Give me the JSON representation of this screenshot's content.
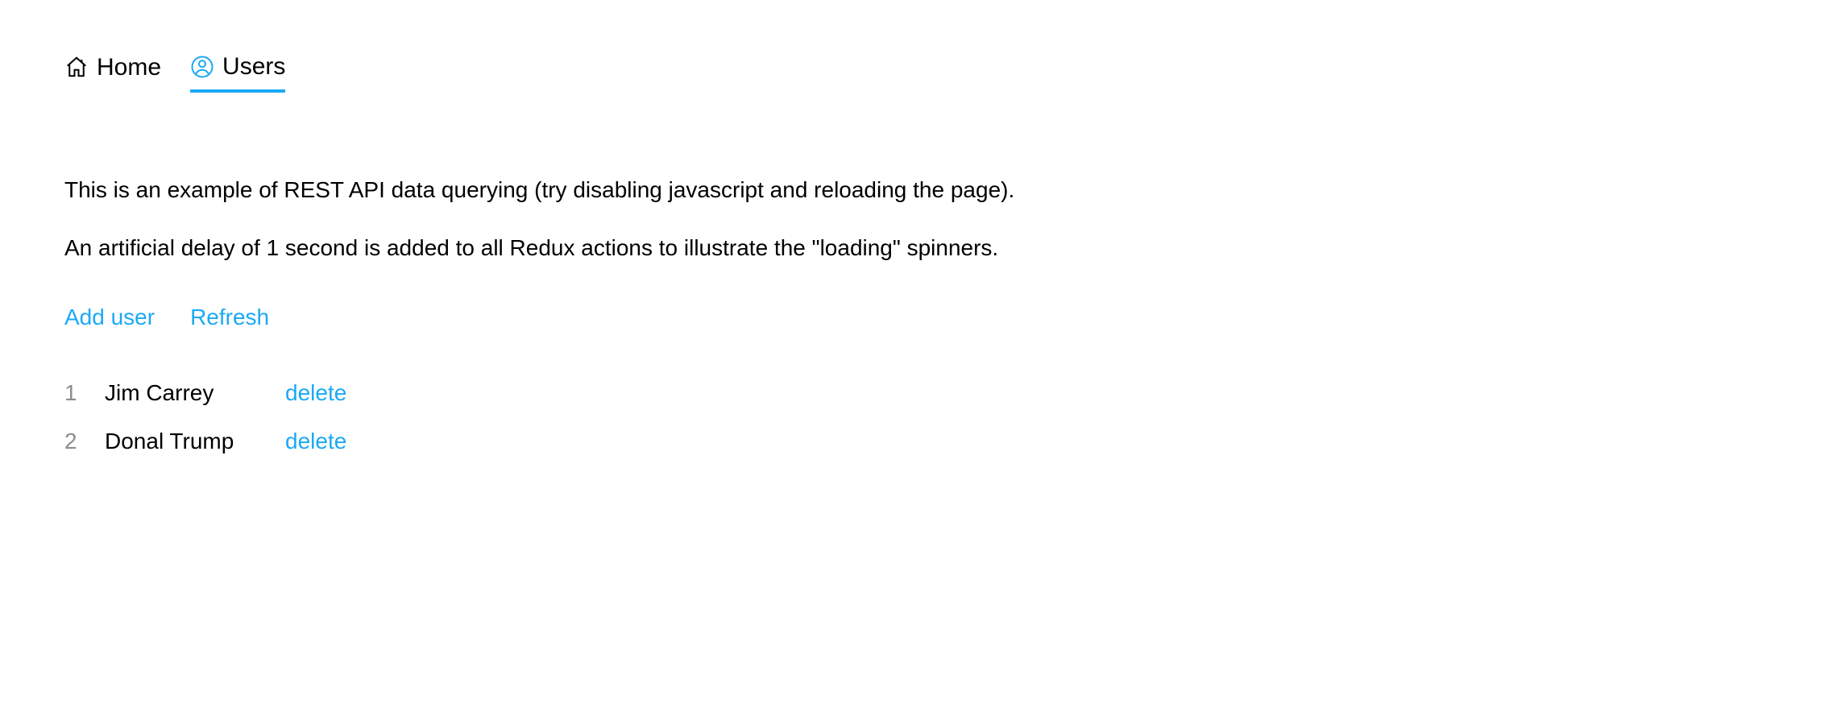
{
  "nav": {
    "items": [
      {
        "label": "Home",
        "active": false
      },
      {
        "label": "Users",
        "active": true
      }
    ]
  },
  "description": {
    "line1": "This is an example of REST API data querying (try disabling javascript and reloading the page).",
    "line2": "An artificial delay of 1 second is added to all Redux actions to illustrate the \"loading\" spinners."
  },
  "actions": {
    "add_user": "Add user",
    "refresh": "Refresh"
  },
  "users": [
    {
      "id": "1",
      "name": "Jim Carrey",
      "delete_label": "delete"
    },
    {
      "id": "2",
      "name": "Donal Trump",
      "delete_label": "delete"
    }
  ]
}
